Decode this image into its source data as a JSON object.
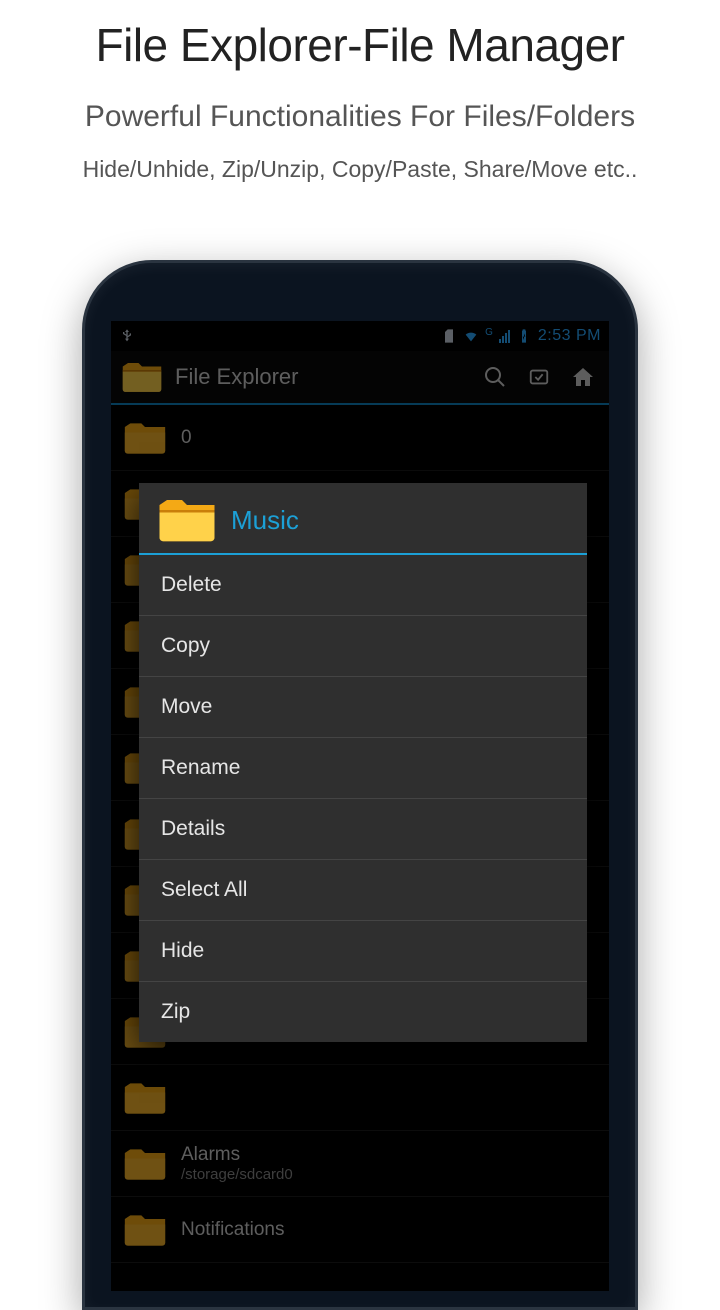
{
  "promo": {
    "title": "File Explorer-File Manager",
    "subtitle": "Powerful Functionalities For Files/Folders",
    "features": "Hide/Unhide, Zip/Unzip, Copy/Paste, Share/Move etc.."
  },
  "status": {
    "clock": "2:53 PM",
    "network_label": "G"
  },
  "actionbar": {
    "title": "File Explorer"
  },
  "breadcrumb": {
    "name": "0"
  },
  "context_menu": {
    "target": "Music",
    "items": [
      "Delete",
      "Copy",
      "Move",
      "Rename",
      "Details",
      "Select All",
      "Hide",
      "Zip"
    ]
  },
  "list": [
    {
      "name": "Alarms",
      "sub": "/storage/sdcard0"
    },
    {
      "name": "Notifications",
      "sub": ""
    }
  ],
  "colors": {
    "accent": "#1ca0d6",
    "status_accent": "#2aa8ff"
  }
}
